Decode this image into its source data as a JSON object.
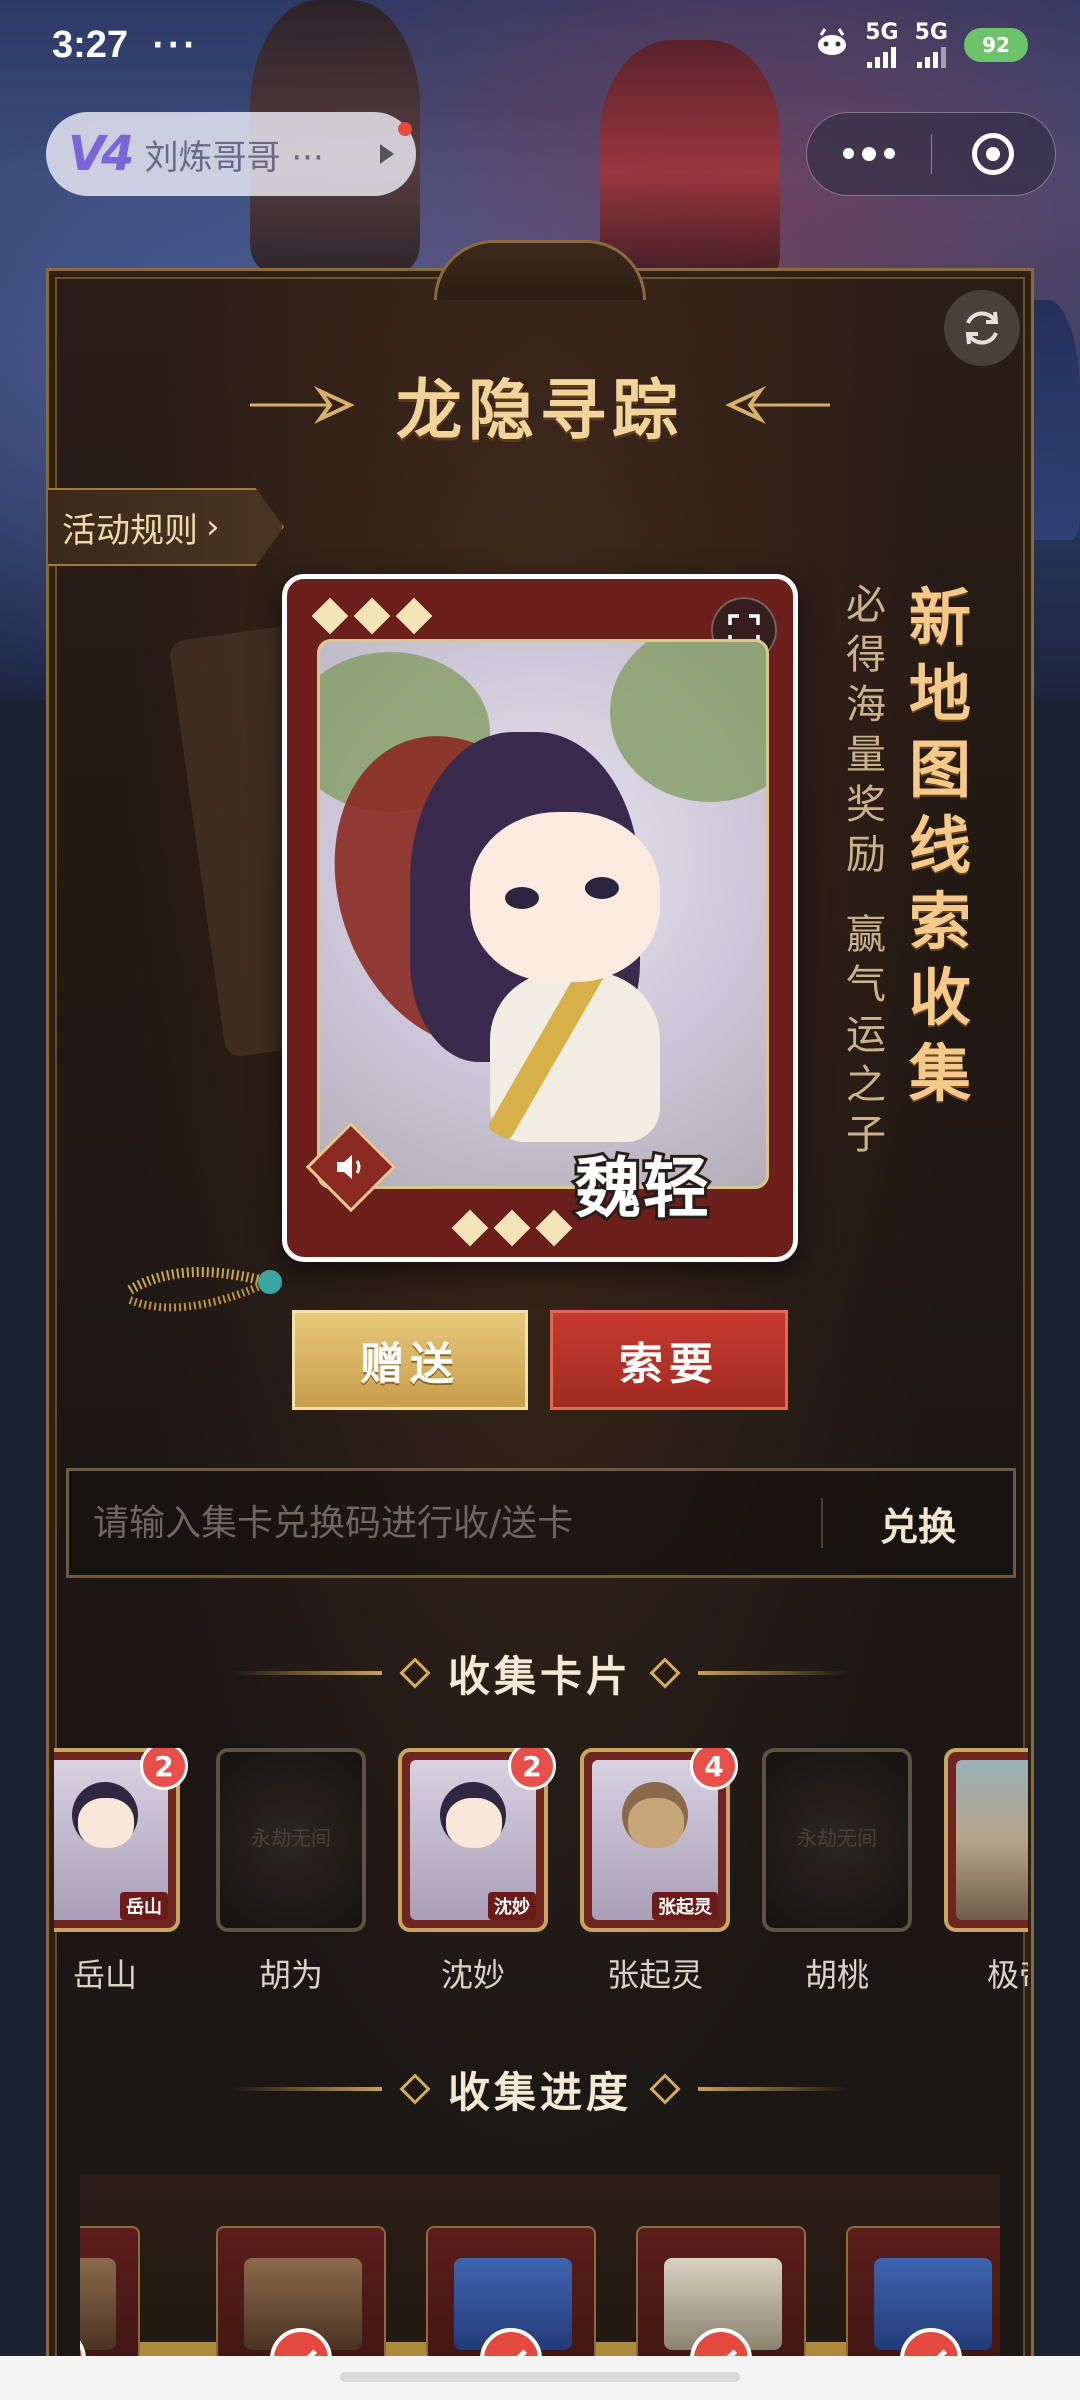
{
  "status_bar": {
    "time": "3:27",
    "extra": "···",
    "network_1": "5G",
    "network_2": "5G",
    "battery": "92"
  },
  "header": {
    "logo": "V4",
    "user_name": "刘炼哥哥 ···"
  },
  "event": {
    "title": "龙隐寻踪",
    "rules_label": "活动规则",
    "slogan_small": [
      "必",
      "得",
      "海",
      "量",
      "奖",
      "励",
      "",
      "赢",
      "气",
      "运",
      "之",
      "子"
    ],
    "slogan_big": [
      "新",
      "地",
      "图",
      "线",
      "索",
      "收",
      "集"
    ]
  },
  "featured_card": {
    "name": "魏轻"
  },
  "actions": {
    "give_label": "赠送",
    "ask_label": "索要"
  },
  "redeem": {
    "placeholder": "请输入集卡兑换码进行收/送卡",
    "button_label": "兑换"
  },
  "collect_cards": {
    "title": "收集卡片",
    "items": [
      {
        "name": "岳山",
        "tag": "岳山",
        "count": "2",
        "owned": true
      },
      {
        "name": "胡为",
        "tag": "",
        "count": "",
        "owned": false
      },
      {
        "name": "沈妙",
        "tag": "沈妙",
        "count": "2",
        "owned": true
      },
      {
        "name": "张起灵",
        "tag": "张起灵",
        "count": "4",
        "owned": true
      },
      {
        "name": "胡桃",
        "tag": "",
        "count": "",
        "owned": false
      },
      {
        "name": "极帝",
        "tag": "",
        "count": "",
        "owned": true
      }
    ]
  },
  "collect_progress": {
    "title": "收集进度",
    "items_completed": 5
  },
  "colors": {
    "accent_gold": "#c9a560",
    "button_red": "#c63a2e",
    "badge_red": "#e7504a"
  }
}
